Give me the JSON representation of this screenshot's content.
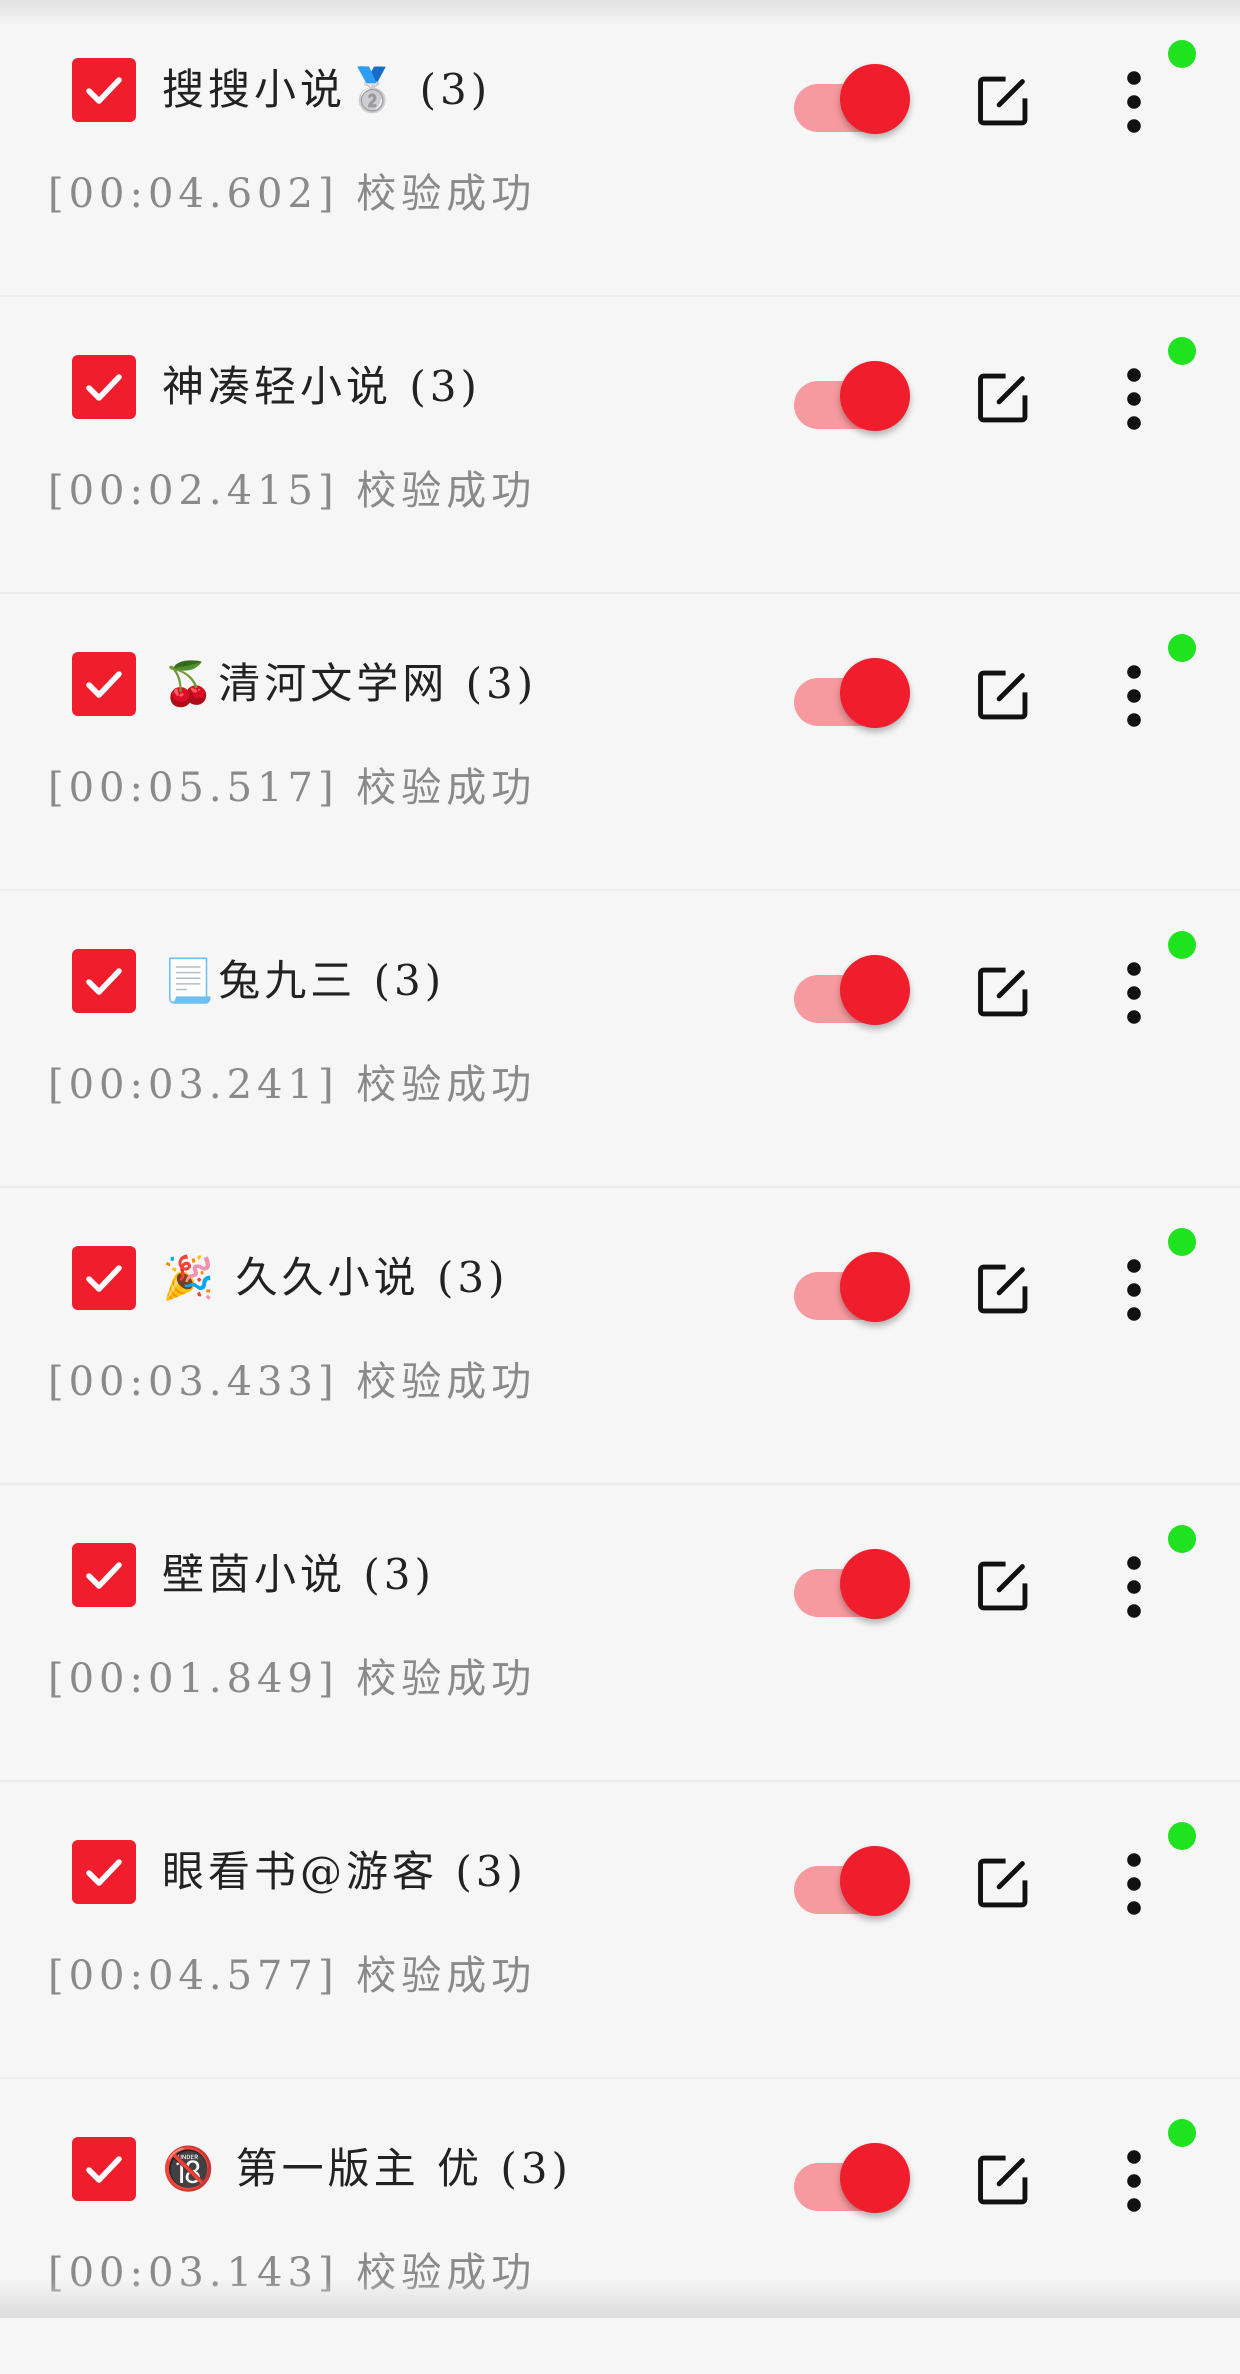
{
  "colors": {
    "accent": "#f01e2c",
    "switch_track": "#f79a9f",
    "status_ok": "#1ee31e",
    "name_text": "#222222",
    "status_text": "#8a8a8a"
  },
  "icons": {
    "checkbox": "checkmark-icon",
    "edit": "edit-icon",
    "more": "more-vertical-icon"
  },
  "sources": [
    {
      "name": "搜搜小说🥈 (3)",
      "status": "[00:04.602] 校验成功",
      "checked": true,
      "enabled": true
    },
    {
      "name": "神凑轻小说 (3)",
      "status": "[00:02.415] 校验成功",
      "checked": true,
      "enabled": true
    },
    {
      "name": "🍒清河文学网 (3)",
      "status": "[00:05.517] 校验成功",
      "checked": true,
      "enabled": true
    },
    {
      "name": "📃兔九三 (3)",
      "status": "[00:03.241] 校验成功",
      "checked": true,
      "enabled": true
    },
    {
      "name": "🎉 久久小说 (3)",
      "status": "[00:03.433] 校验成功",
      "checked": true,
      "enabled": true
    },
    {
      "name": "壁茵小说 (3)",
      "status": "[00:01.849] 校验成功",
      "checked": true,
      "enabled": true
    },
    {
      "name": "眼看书@游客 (3)",
      "status": "[00:04.577] 校验成功",
      "checked": true,
      "enabled": true
    },
    {
      "name": "🔞 第一版主  优 (3)",
      "status": "[00:03.143] 校验成功",
      "checked": true,
      "enabled": true
    }
  ]
}
